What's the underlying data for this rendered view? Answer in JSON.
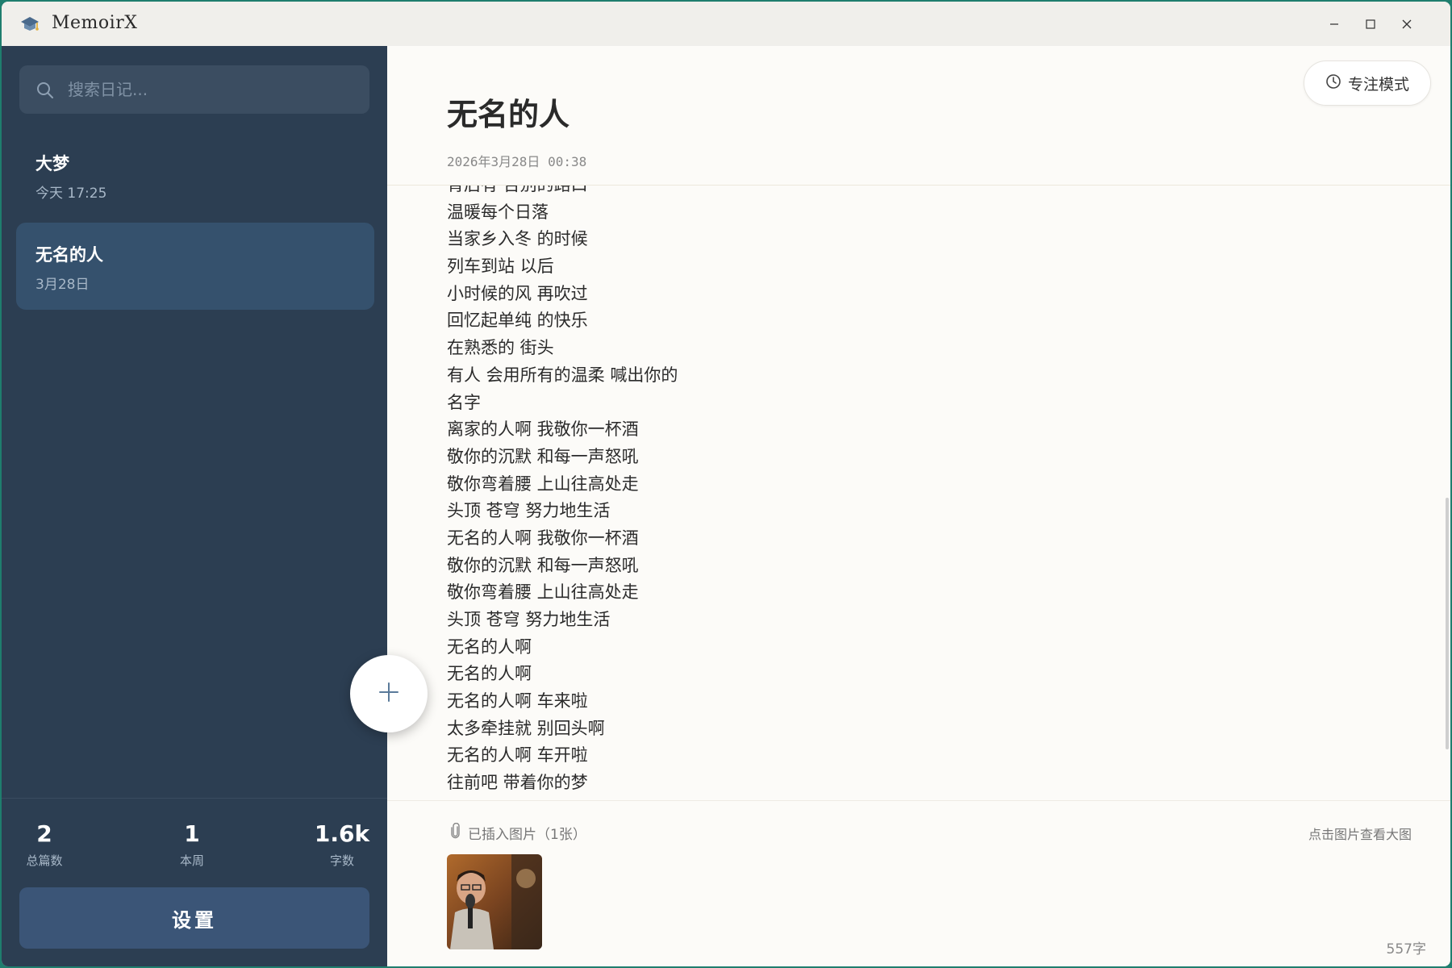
{
  "app": {
    "title": "MemoirX",
    "icons": {
      "logo": "graduation-cap-icon",
      "minimize": "minimize-icon",
      "maximize": "maximize-icon",
      "close": "close-icon"
    }
  },
  "sidebar": {
    "search": {
      "placeholder": "搜索日记..."
    },
    "entries": [
      {
        "title": "大梦",
        "date": "今天 17:25"
      },
      {
        "title": "无名的人",
        "date": "3月28日"
      }
    ],
    "stats": [
      {
        "value": "2",
        "label": "总篇数"
      },
      {
        "value": "1",
        "label": "本周"
      },
      {
        "value": "1.6k",
        "label": "字数"
      }
    ],
    "settings_label": "设置"
  },
  "main": {
    "focus_mode_label": "专注模式",
    "title": "无名的人",
    "date": "2026年3月28日 00:38",
    "lines": [
      "背后有 告别的路口",
      "温暖每个日落",
      "当家乡入冬 的时候",
      "列车到站 以后",
      "小时候的风 再吹过",
      "回忆起单纯 的快乐",
      "在熟悉的 街头",
      "有人 会用所有的温柔 喊出你的",
      "名字",
      "离家的人啊 我敬你一杯酒",
      "敬你的沉默 和每一声怒吼",
      "敬你弯着腰 上山往高处走",
      "头顶 苍穹 努力地生活",
      "无名的人啊 我敬你一杯酒",
      "敬你的沉默 和每一声怒吼",
      "敬你弯着腰 上山往高处走",
      "头顶 苍穹 努力地生活",
      "无名的人啊",
      "无名的人啊",
      "无名的人啊 车来啦",
      "太多牵挂就 别回头啊",
      "无名的人啊 车开啦",
      "往前吧 带着你的梦"
    ],
    "attachments_label": "已插入图片（1张）",
    "attachments_hint": "点击图片查看大图",
    "word_count": "557字"
  }
}
